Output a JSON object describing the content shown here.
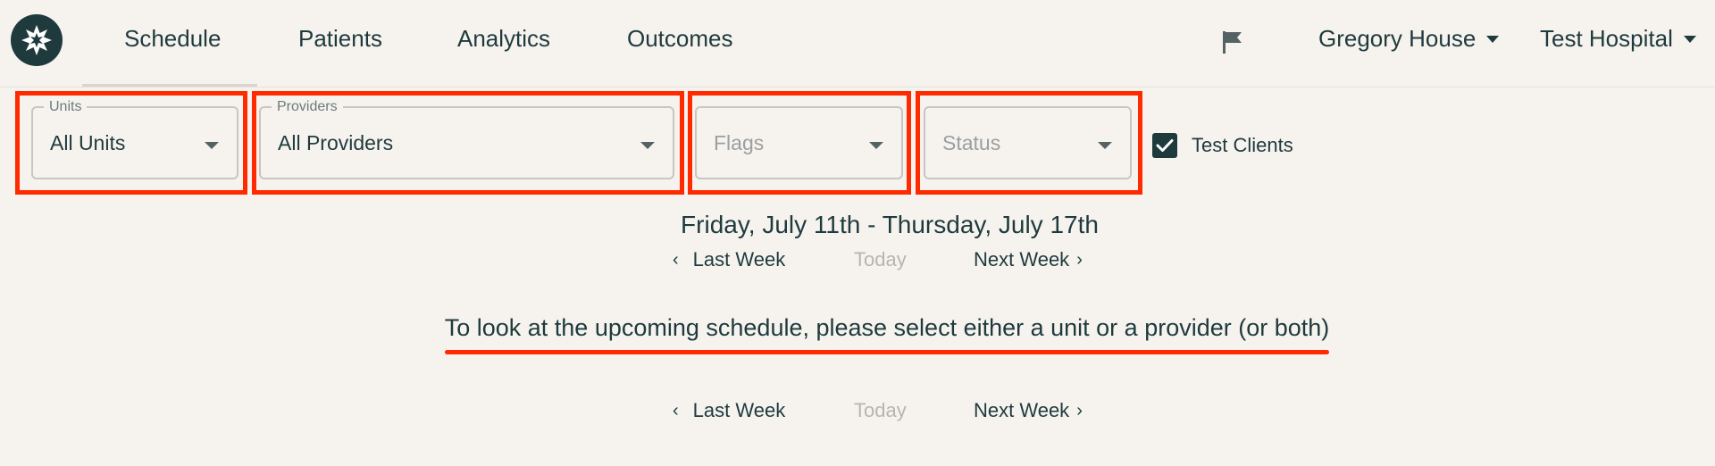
{
  "nav": {
    "items": [
      {
        "label": "Schedule"
      },
      {
        "label": "Patients"
      },
      {
        "label": "Analytics"
      },
      {
        "label": "Outcomes"
      }
    ],
    "user": "Gregory House",
    "hospital": "Test Hospital"
  },
  "filters": {
    "units": {
      "legend": "Units",
      "value": "All Units"
    },
    "providers": {
      "legend": "Providers",
      "value": "All Providers"
    },
    "flags": {
      "placeholder": "Flags"
    },
    "status": {
      "placeholder": "Status"
    },
    "test_clients": {
      "label": "Test Clients",
      "checked": true
    }
  },
  "schedule": {
    "date_range": "Friday, July 11th - Thursday, July 17th",
    "prev_label": "Last Week",
    "today_label": "Today",
    "next_label": "Next Week",
    "message": "To look at the upcoming schedule, please select either a unit or a provider (or both)"
  },
  "colors": {
    "background": "#f6f3ef",
    "primary": "#1f3a3d",
    "highlight": "#ff2a00",
    "muted": "#b5b5b2"
  },
  "icons": {
    "logo": "star-badge-icon",
    "flag": "flag-icon",
    "caret": "caret-down-icon",
    "check": "checkmark-icon",
    "prev": "chevron-left-icon",
    "next": "chevron-right-icon"
  }
}
